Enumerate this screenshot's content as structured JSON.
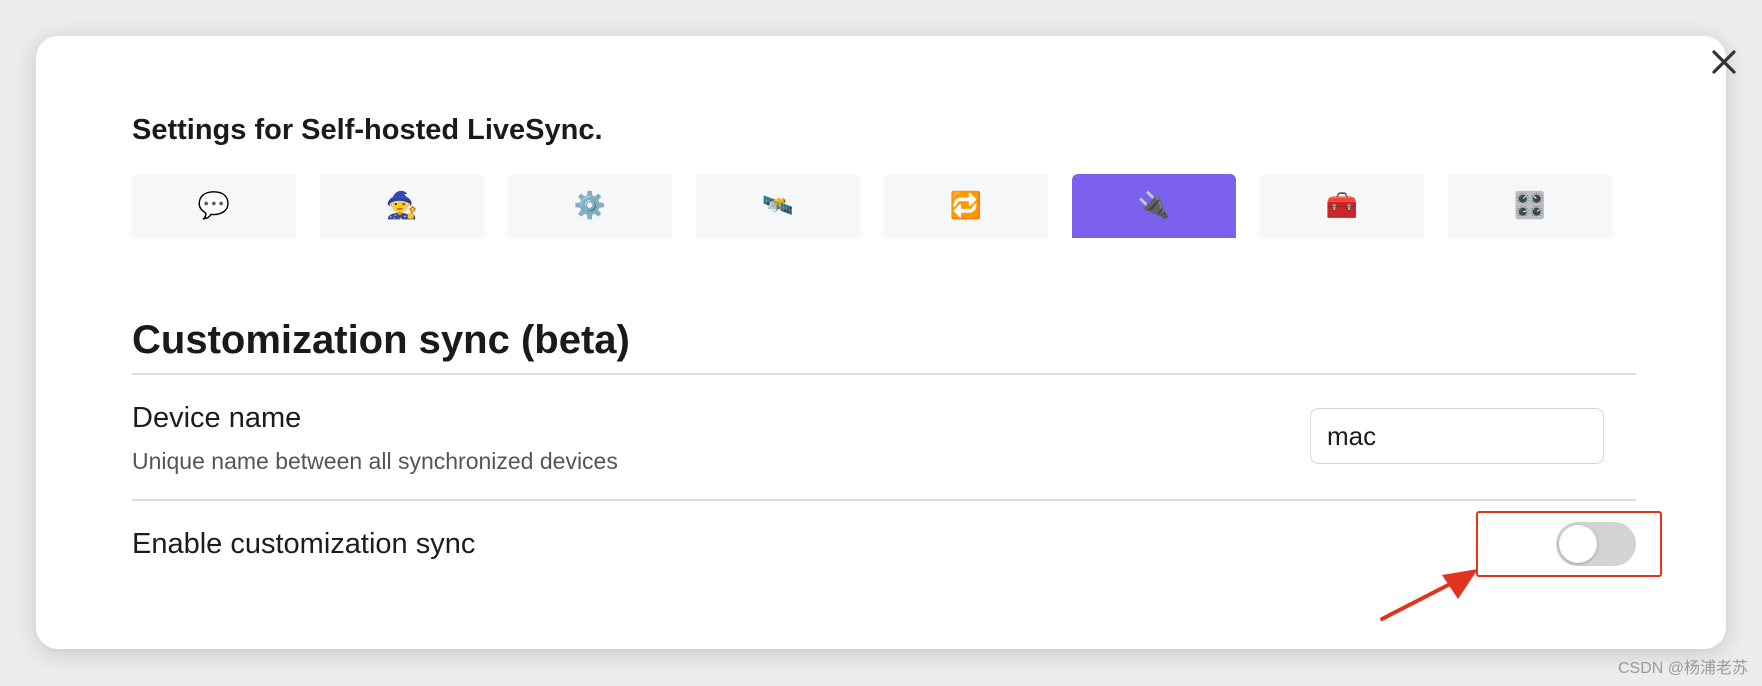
{
  "modal": {
    "title": "Settings for Self-hosted LiveSync."
  },
  "tabs": [
    {
      "icon": "speech-bubble-icon",
      "glyph": "💬",
      "active": false
    },
    {
      "icon": "wizard-icon",
      "glyph": "🧙",
      "active": false
    },
    {
      "icon": "gear-icon",
      "glyph": "⚙️",
      "active": false
    },
    {
      "icon": "satellite-icon",
      "glyph": "🛰️",
      "active": false
    },
    {
      "icon": "repeat-icon",
      "glyph": "🔁",
      "active": false
    },
    {
      "icon": "plug-icon",
      "glyph": "🔌",
      "active": true
    },
    {
      "icon": "toolbox-icon",
      "glyph": "🧰",
      "active": false
    },
    {
      "icon": "control-knobs-icon",
      "glyph": "🎛️",
      "active": false
    }
  ],
  "section": {
    "heading": "Customization sync (beta)"
  },
  "settings": {
    "device_name": {
      "label": "Device name",
      "description": "Unique name between all synchronized devices",
      "value": "mac"
    },
    "enable_sync": {
      "label": "Enable customization sync",
      "enabled": false
    }
  },
  "annotation": {
    "color": "#e0341e"
  },
  "colors": {
    "accent": "#7b61ed",
    "tab_background": "#f6f7f8"
  },
  "watermark": "CSDN @杨浦老苏"
}
